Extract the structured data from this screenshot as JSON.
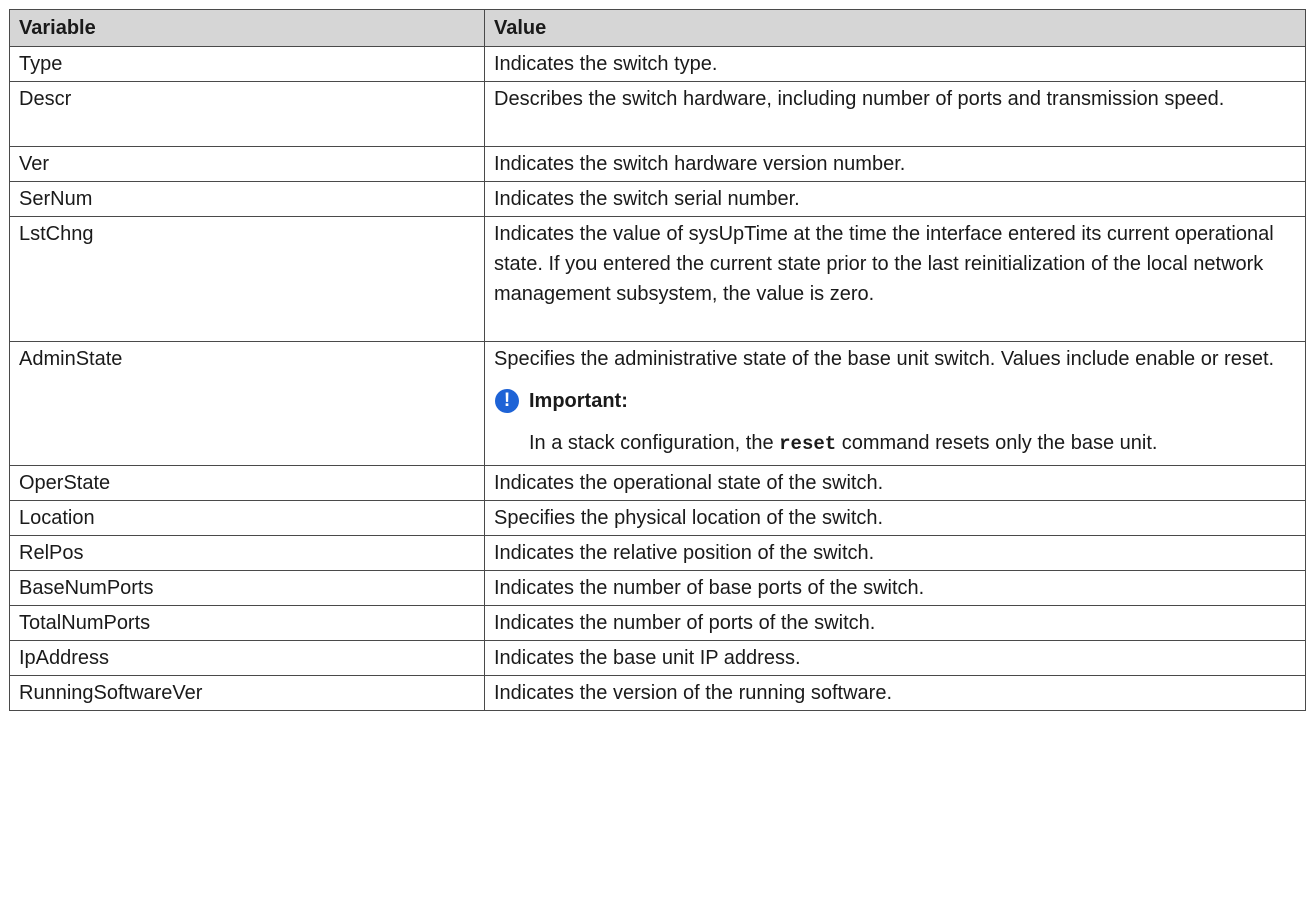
{
  "header": {
    "variable": "Variable",
    "value": "Value"
  },
  "rows": [
    {
      "variable": "Type",
      "value": "Indicates the switch type."
    },
    {
      "variable": "Descr",
      "value": "Describes the switch hardware, including number of ports and transmission speed."
    },
    {
      "variable": "Ver",
      "value": "Indicates the switch hardware version number."
    },
    {
      "variable": "SerNum",
      "value": "Indicates the switch serial number."
    },
    {
      "variable": "LstChng",
      "value": "Indicates the value of sysUpTime at the time the interface entered its current operational state. If you entered the current state prior to the last reinitialization of the local network management subsystem, the value is zero."
    },
    {
      "variable": "AdminState",
      "value": "Specifies the administrative state of the base unit switch. Values include enable or reset."
    },
    {
      "variable": "OperState",
      "value": "Indicates the operational state of the switch."
    },
    {
      "variable": "Location",
      "value": "Specifies the physical location of the switch."
    },
    {
      "variable": "RelPos",
      "value": "Indicates the relative position of the switch."
    },
    {
      "variable": "BaseNumPorts",
      "value": "Indicates the number of base ports of the switch."
    },
    {
      "variable": "TotalNumPorts",
      "value": "Indicates the number of ports of the switch."
    },
    {
      "variable": "IpAddress",
      "value": "Indicates the base unit IP address."
    },
    {
      "variable": "RunningSoftwareVer",
      "value": "Indicates the version of the running software."
    }
  ],
  "admin_note": {
    "icon": "important-icon",
    "icon_glyph": "!",
    "icon_color": "#1e63d6",
    "title": "Important:",
    "text_before": "In a stack configuration, the ",
    "command": "reset",
    "text_after": " command resets only the base unit."
  }
}
